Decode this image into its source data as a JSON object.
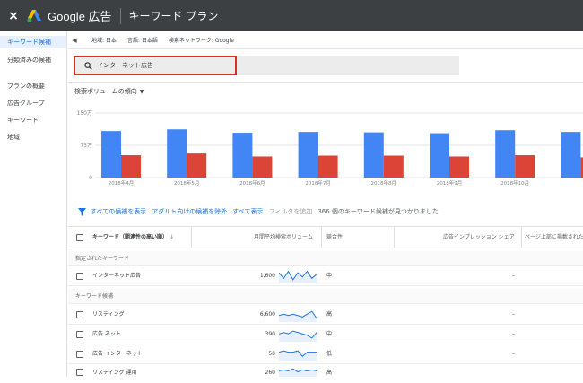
{
  "topbar": {
    "close_icon": "×",
    "brand": "Google 広告",
    "title": "キーワード プラン"
  },
  "sidebar": {
    "items": [
      {
        "label": "キーワード候補",
        "active": true
      },
      {
        "label": "分類済みの候補",
        "active": false
      },
      {
        "label": "プランの概要",
        "active": false
      },
      {
        "label": "広告グループ",
        "active": false
      },
      {
        "label": "キーワード",
        "active": false
      },
      {
        "label": "地域",
        "active": false
      }
    ]
  },
  "location_bar": {
    "location": "地域: 日本",
    "language": "言語: 日本語",
    "network": "検索ネットワーク: Google"
  },
  "search": {
    "value": "インターネット広告"
  },
  "chart": {
    "dropdown_label": "検索ボリュームの傾向"
  },
  "chart_data": {
    "type": "bar",
    "categories": [
      "2018年4月",
      "2018年5月",
      "2018年6月",
      "2018年7月",
      "2018年8月",
      "2018年9月",
      "2018年10月",
      ""
    ],
    "series": [
      {
        "values": [
          1080000,
          1120000,
          1040000,
          1060000,
          1050000,
          1030000,
          1100000,
          1060000
        ],
        "color": "#4285f4"
      },
      {
        "values": [
          520000,
          560000,
          490000,
          510000,
          510000,
          490000,
          520000,
          470000
        ],
        "color": "#db4437"
      }
    ],
    "yticks": [
      "150万",
      "75万",
      "0"
    ],
    "ylim": [
      0,
      1500000
    ],
    "grid": true
  },
  "filter": {
    "show_all": "すべての候補を表示",
    "adult": "アダルト向けの候補を除外",
    "show_all_short": "すべて表示",
    "add_filter": "フィルタを追加",
    "count": "366 個のキーワード候補が見つかりました"
  },
  "table": {
    "headers": {
      "keyword": "キーワード（関連性の高い順）",
      "sort_icon": "↓",
      "volume": "月間平均検索ボリューム",
      "competition": "競合性",
      "impression_share": "広告インプレッション シェア",
      "top_bid": "ページ上部に掲載された"
    },
    "group1": "指定されたキーワード",
    "group2": "キーワード候補",
    "rows": [
      {
        "keyword": "インターネット広告",
        "volume": "1,600",
        "competition": "中",
        "share": "–",
        "spark": [
          7,
          3,
          8,
          2,
          7,
          4,
          8,
          3,
          6
        ]
      },
      {
        "keyword": "リスティング",
        "volume": "6,600",
        "competition": "高",
        "share": "–",
        "spark": [
          4,
          5,
          4,
          5,
          4,
          3,
          5,
          7,
          2
        ]
      },
      {
        "keyword": "広告 ネット",
        "volume": "390",
        "competition": "中",
        "share": "–",
        "spark": [
          5,
          6,
          5,
          7,
          6,
          5,
          4,
          2,
          6
        ]
      },
      {
        "keyword": "広告 インターネット",
        "volume": "50",
        "competition": "低",
        "share": "–",
        "spark": [
          6,
          7,
          6,
          6,
          7,
          3,
          6,
          6,
          6
        ]
      },
      {
        "keyword": "リスティング 運用",
        "volume": "260",
        "competition": "高",
        "share": "–",
        "spark": [
          5,
          6,
          5,
          7,
          4,
          6,
          5,
          6,
          5
        ]
      }
    ]
  }
}
